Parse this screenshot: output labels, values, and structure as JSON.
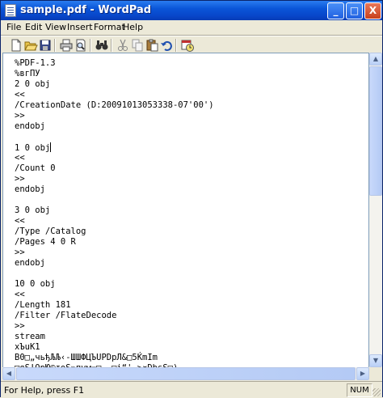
{
  "window": {
    "title": "sample.pdf - WordPad"
  },
  "caption_buttons": {
    "minimize": "_",
    "maximize": "□",
    "close": "X"
  },
  "menu": [
    "File",
    "Edit",
    "View",
    "Insert",
    "Format",
    "Help"
  ],
  "toolbar": [
    "new-icon",
    "open-icon",
    "save-icon",
    "print-icon",
    "print-preview-icon",
    "find-icon",
    "cut-icon",
    "copy-icon",
    "paste-icon",
    "undo-icon",
    "date-time-icon"
  ],
  "document": {
    "lines": [
      "%PDF-1.3",
      "%вгПУ",
      "2 0 obj",
      "<<",
      "/CreationDate (D:20091013053338-07'00')",
      ">>",
      "endobj",
      "",
      "1 0 obj",
      "<<",
      "/Count 0",
      ">>",
      "endobj",
      "",
      "3 0 obj",
      "<<",
      "/Type /Catalog",
      "/Pages 4 0 R",
      ">>",
      "endobj",
      "",
      "10 0 obj",
      "<<",
      "/Length 181",
      "/Filter /FlateDecode",
      ">>",
      "stream",
      "xЪuK1",
      "B0□„чьђЉЉ‹-ШШФЦЪUPDpЛ&□5ЌmIm",
      "□яS!QpЮ©тоЅ»пvм¬□, □i“'->¤DbsЅ□)"
    ],
    "caret_line": 8
  },
  "status": {
    "text": "For Help, press F1",
    "num": "NUM"
  }
}
